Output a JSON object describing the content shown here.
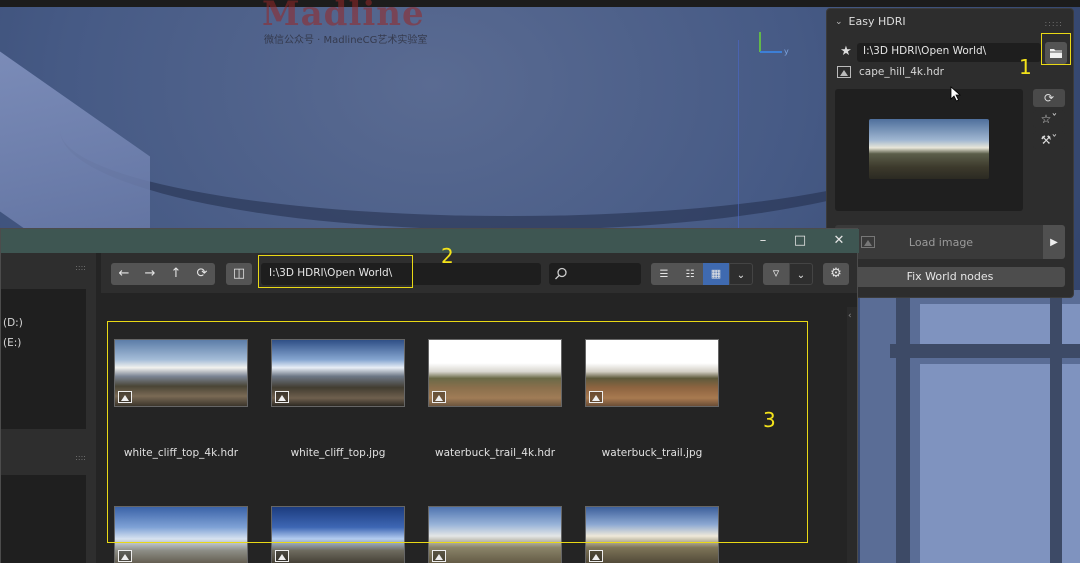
{
  "watermark": {
    "main": "Madline",
    "sub": "微信公众号 · MadlineCG艺术实验室"
  },
  "hdri_panel": {
    "title": "Easy HDRI",
    "path": "I:\\3D HDRI\\Open World\\",
    "current_file": "cape_hill_4k.hdr",
    "load_image_label": "Load image",
    "fix_world_label": "Fix World nodes"
  },
  "markers": {
    "one": "1",
    "two": "2",
    "three": "3"
  },
  "file_browser": {
    "path": "I:\\3D HDRI\\Open World\\",
    "drives": [
      "(D:)",
      "(E:)"
    ],
    "files": [
      {
        "name": "white_cliff_top_4k.hdr"
      },
      {
        "name": "white_cliff_top.jpg"
      },
      {
        "name": "waterbuck_trail_4k.hdr"
      },
      {
        "name": "waterbuck_trail.jpg"
      }
    ]
  },
  "colors": {
    "highlight": "#e9d915",
    "titlebar": "#3e5652",
    "active_view": "#3f6ab0"
  }
}
